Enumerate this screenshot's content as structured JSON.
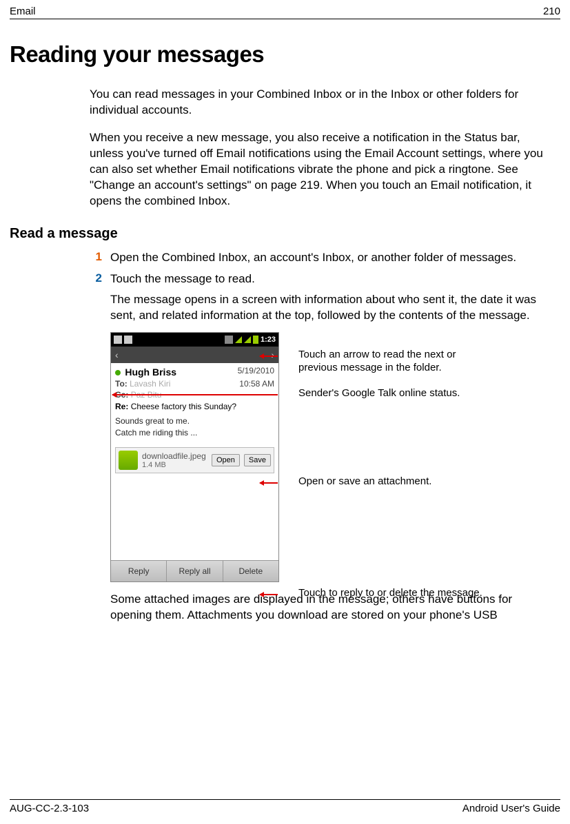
{
  "header": {
    "section": "Email",
    "page_number": "210"
  },
  "title": "Reading your messages",
  "intro_p1": "You can read messages in your Combined Inbox or in the Inbox or other folders for individual accounts.",
  "intro_p2": "When you receive a new message, you also receive a notification in the Status bar, unless you've turned off Email notifications using the Email Account settings, where you can also set whether Email notifications vibrate the phone and pick a ringtone. See \"Change an account's settings\" on page 219. When you touch an Email notification, it opens the combined Inbox.",
  "subhead": "Read a message",
  "steps": [
    {
      "num": "1",
      "text": "Open the Combined Inbox, an account's Inbox, or another folder of messages."
    },
    {
      "num": "2",
      "text": "Touch the message to read."
    }
  ],
  "step2_cont": "The message opens in a screen with information about who sent it, the date it was sent, and related information at the top, followed by the contents of the message.",
  "screenshot": {
    "status_time": "1:23",
    "sender": "Hugh Briss",
    "date": "5/19/2010",
    "time": "10:58 AM",
    "to_label": "To:",
    "to_value": "Lavash Kiri",
    "cc_label": "Cc:",
    "cc_value": "Paz Bitu",
    "subject_prefix": "Re:",
    "subject": "Cheese factory this Sunday?",
    "body_line1": "Sounds great to me.",
    "body_line2": "Catch me riding this ...",
    "attachment": {
      "filename": "downloadfile.jpeg",
      "size": "1.4 MB",
      "open": "Open",
      "save": "Save"
    },
    "buttons": {
      "reply": "Reply",
      "reply_all": "Reply all",
      "delete": "Delete"
    }
  },
  "callouts": {
    "arrows": "Touch an arrow to read the next or previous message in the folder.",
    "status": "Sender's Google Talk online status.",
    "attach": "Open or save an attachment.",
    "bottom": "Touch to reply to or delete the message."
  },
  "after_shot": "Some attached images are displayed in the message; others have buttons for opening them. Attachments you download are stored on your phone's USB",
  "footer": {
    "left": "AUG-CC-2.3-103",
    "right": "Android User's Guide"
  }
}
